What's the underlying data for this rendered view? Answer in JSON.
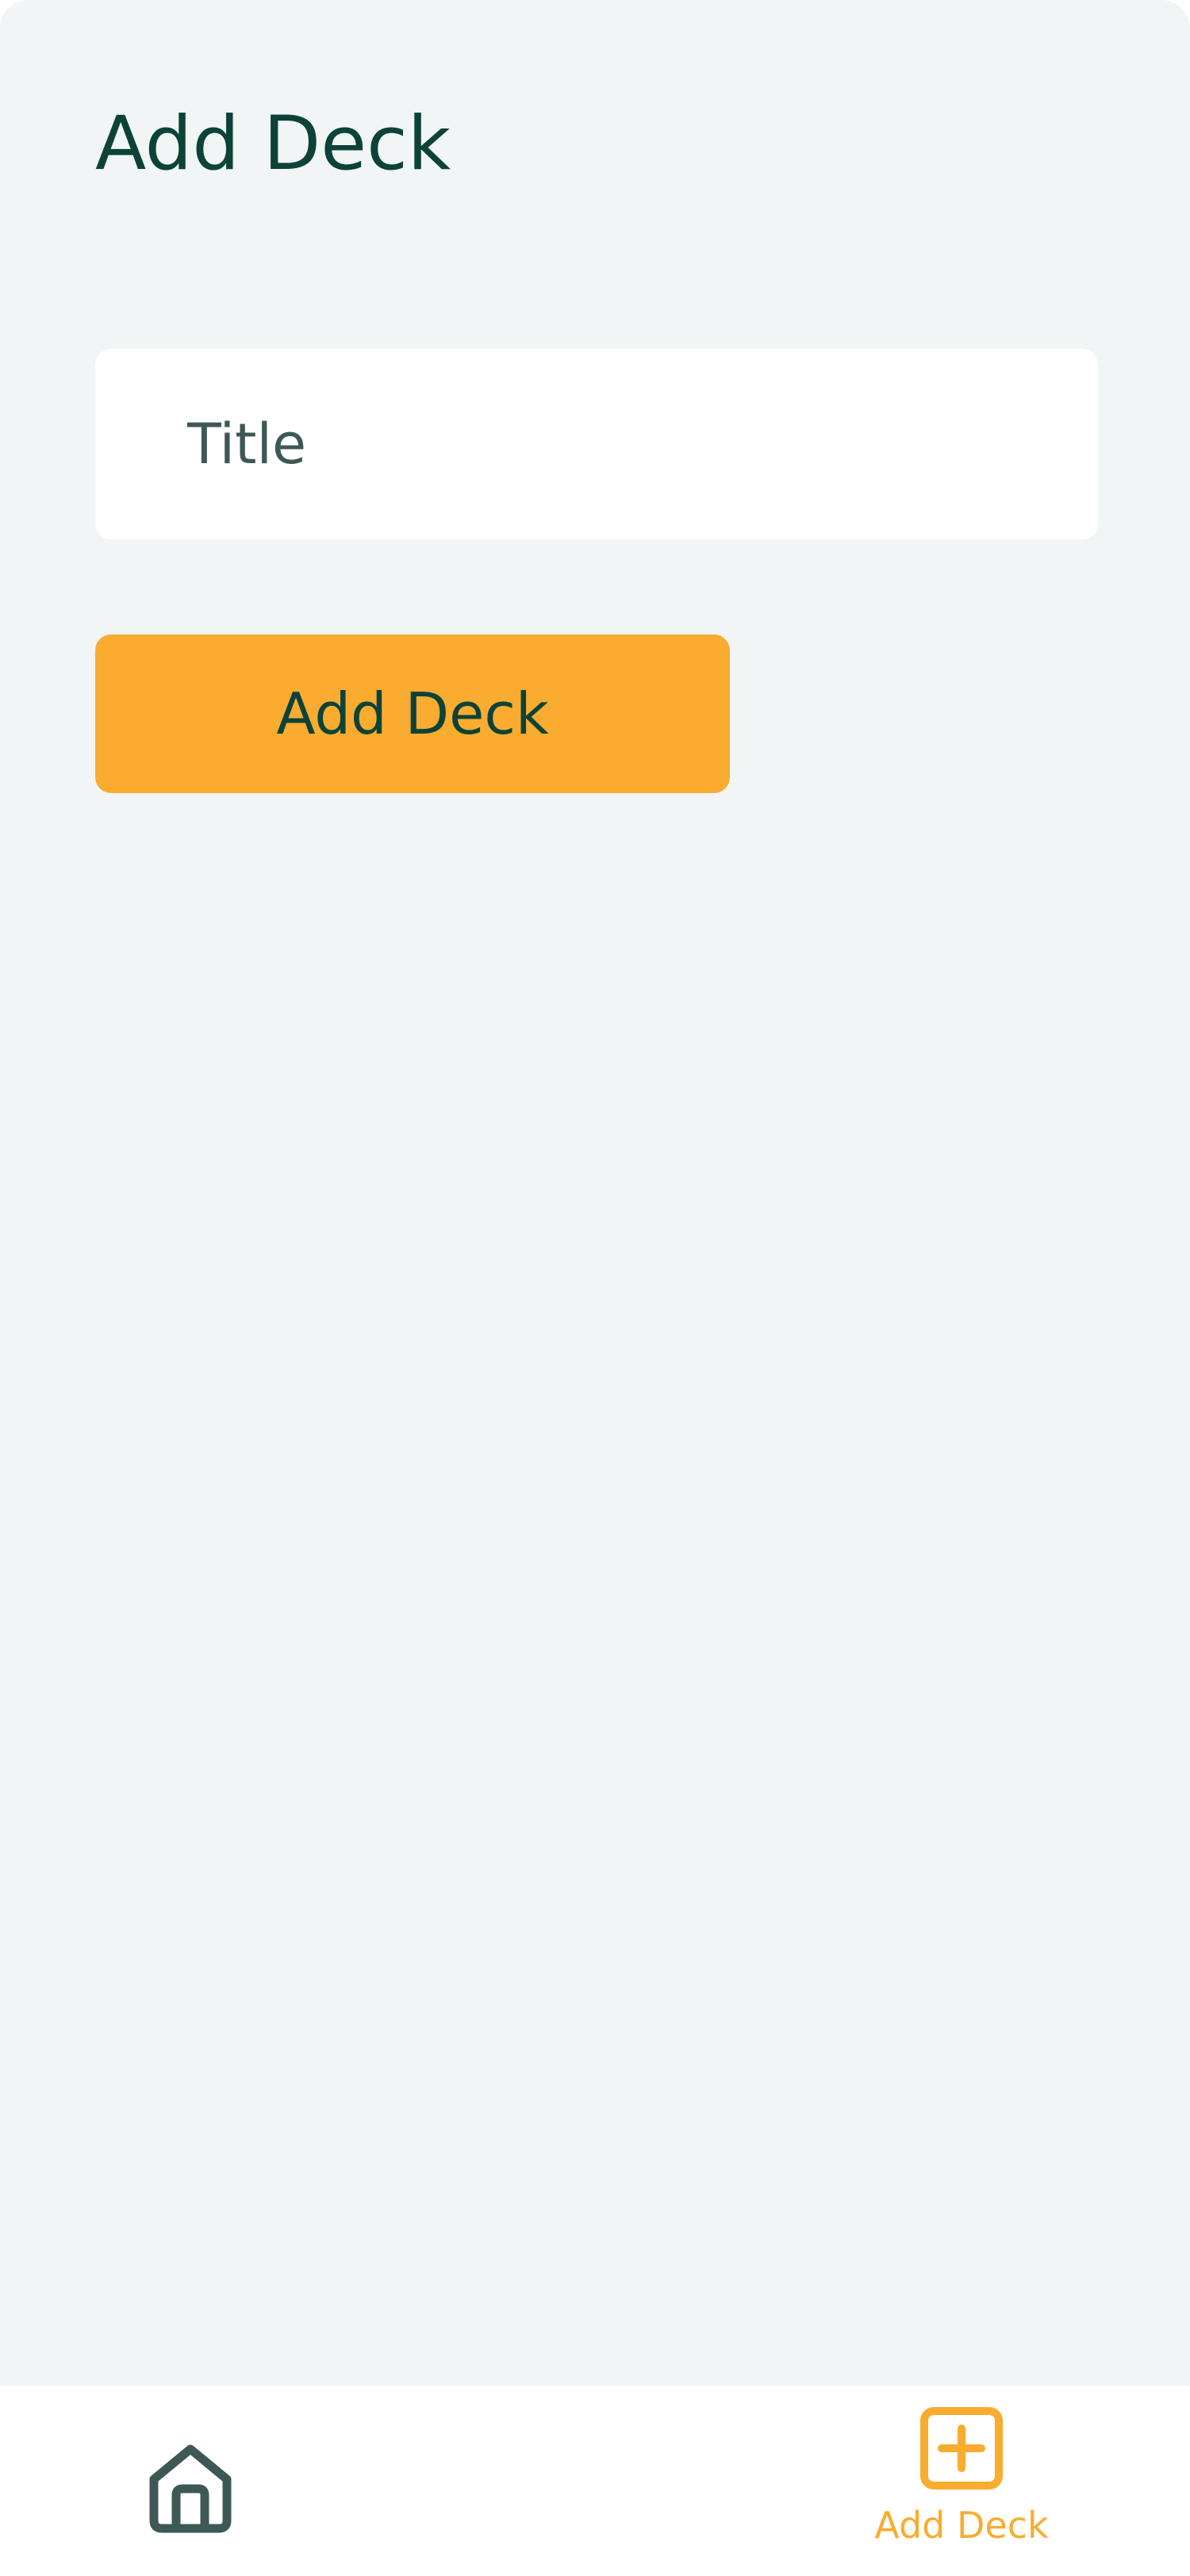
{
  "header": {
    "title": "Add Deck"
  },
  "form": {
    "title_placeholder": "Title",
    "title_value": "",
    "submit_label": "Add Deck"
  },
  "tab_bar": {
    "items": [
      {
        "label": "",
        "icon": "home-icon",
        "active": false
      },
      {
        "label": "Add Deck",
        "icon": "plus-square-icon",
        "active": true
      }
    ]
  },
  "colors": {
    "background": "#f1f5f5",
    "primary_text": "#0d4238",
    "accent": "#f9ac2f",
    "muted": "#3e5856",
    "surface": "#ffffff"
  }
}
